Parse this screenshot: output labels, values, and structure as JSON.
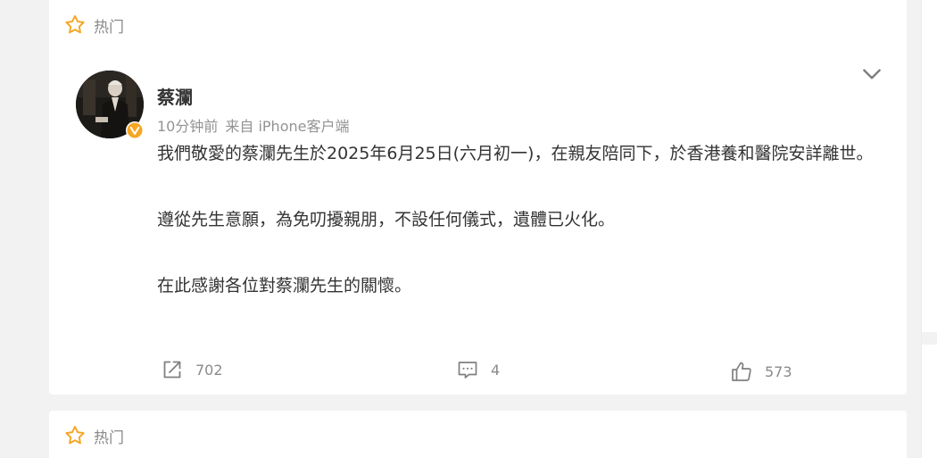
{
  "feed": {
    "hot_label": "热门",
    "post": {
      "author": {
        "name": "蔡瀾",
        "verified": true,
        "badge_color": "#f5a623"
      },
      "meta": {
        "time": "10分钟前",
        "source": "来自 iPhone客户端"
      },
      "paragraphs": [
        "我們敬愛的蔡瀾先生於2025年6月25日(六月初一)，在親友陪同下，於香港養和醫院安詳離世。",
        "遵從先生意願，為免叨擾親朋，不設任何儀式，遺體已火化。",
        "在此感謝各位對蔡瀾先生的關懷。"
      ],
      "actions": {
        "repost_count": "702",
        "comment_count": "4",
        "like_count": "573"
      }
    },
    "next_card": {
      "hot_label": "热门"
    }
  },
  "colors": {
    "star": "#f5a623",
    "icon_gray": "#808080",
    "text_main": "#333333",
    "text_meta": "#939393",
    "page_bg": "#f2f2f2"
  },
  "icons": {
    "hot": "star-icon",
    "menu": "chevron-down-icon",
    "repost": "share-icon",
    "comment": "comment-icon",
    "like": "thumbs-up-icon"
  }
}
